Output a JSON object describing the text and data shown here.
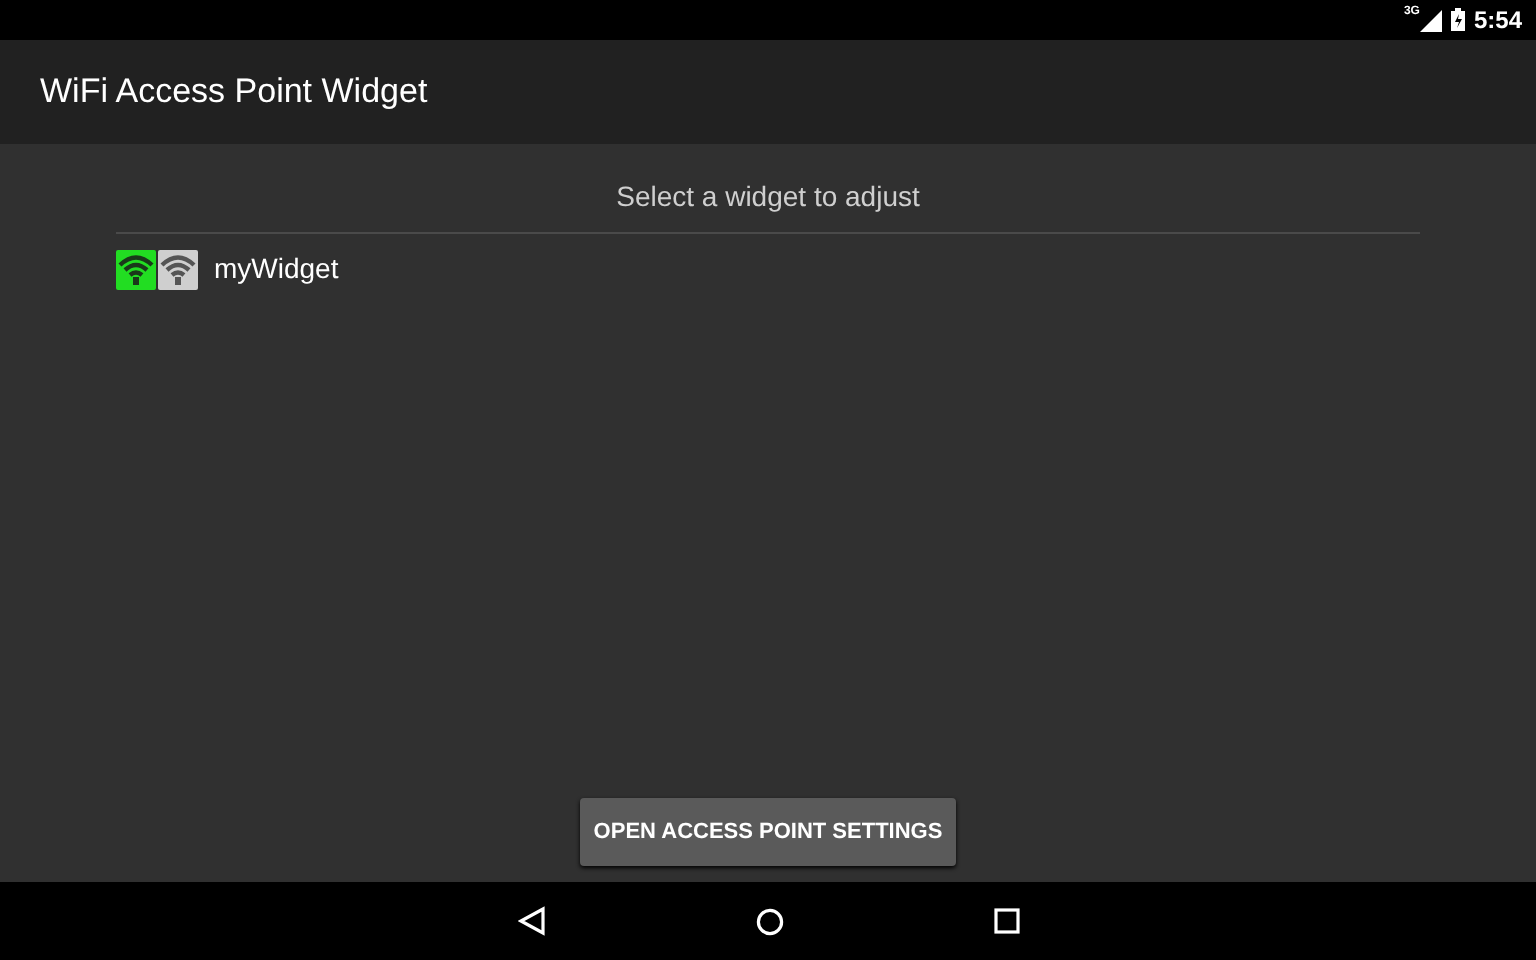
{
  "status_bar": {
    "network": "3G",
    "time": "5:54"
  },
  "app_bar": {
    "title": "WiFi Access Point Widget"
  },
  "prompt": "Select a widget to adjust",
  "widgets": [
    {
      "name": "myWidget"
    }
  ],
  "button": "OPEN ACCESS POINT SETTINGS"
}
